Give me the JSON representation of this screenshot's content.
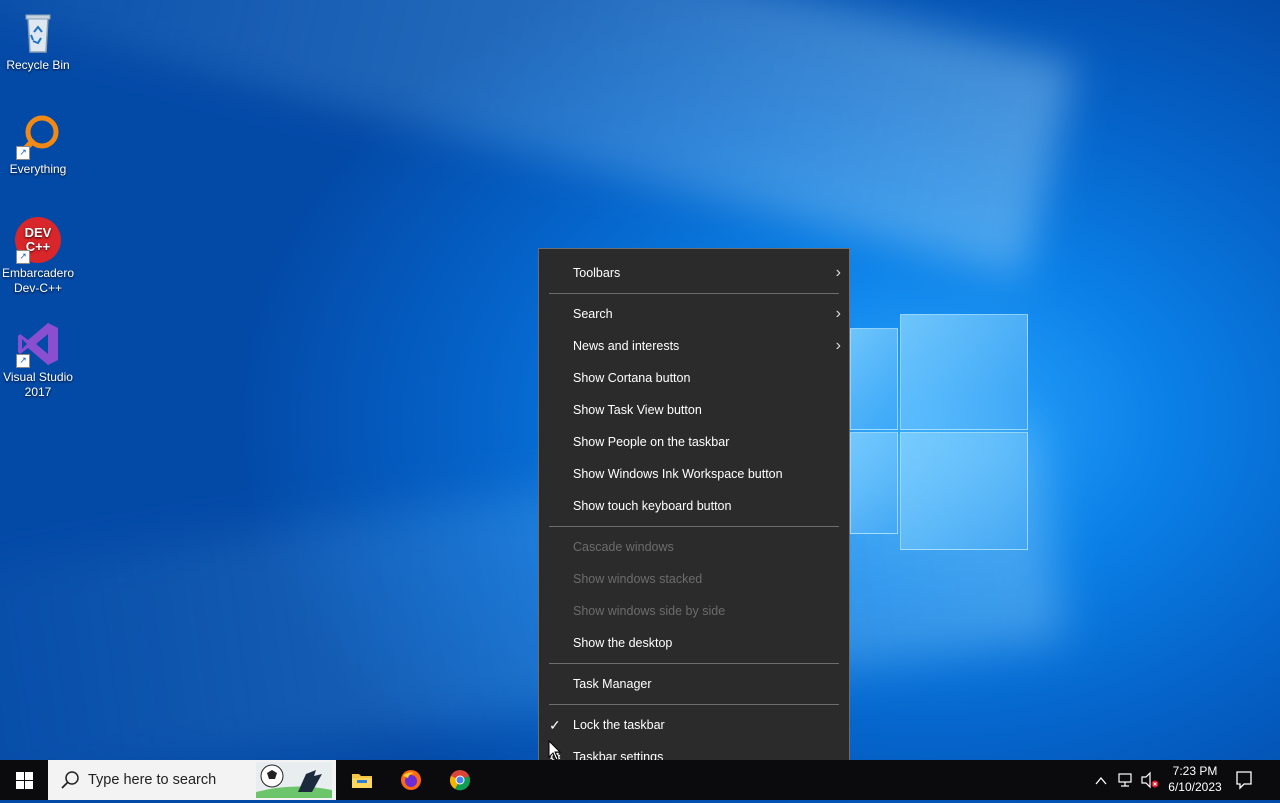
{
  "desktop": {
    "icons": [
      {
        "label": "Recycle Bin",
        "icon": "recycle-bin-icon"
      },
      {
        "label": "Everything",
        "icon": "everything-search-icon"
      },
      {
        "label": "Embarcadero Dev-C++",
        "icon": "devcpp-icon",
        "badge": "DEV C++"
      },
      {
        "label": "Visual Studio 2017",
        "icon": "visual-studio-icon"
      }
    ]
  },
  "context_menu": {
    "items": [
      {
        "label": "Toolbars",
        "submenu": true
      },
      {
        "label": "Search",
        "submenu": true
      },
      {
        "label": "News and interests",
        "submenu": true
      },
      {
        "label": "Show Cortana button"
      },
      {
        "label": "Show Task View button"
      },
      {
        "label": "Show People on the taskbar"
      },
      {
        "label": "Show Windows Ink Workspace button"
      },
      {
        "label": "Show touch keyboard button"
      },
      {
        "label": "Cascade windows",
        "disabled": true
      },
      {
        "label": "Show windows stacked",
        "disabled": true
      },
      {
        "label": "Show windows side by side",
        "disabled": true
      },
      {
        "label": "Show the desktop"
      },
      {
        "label": "Task Manager"
      },
      {
        "label": "Lock the taskbar",
        "checked": true
      },
      {
        "label": "Taskbar settings",
        "icon": "gear-icon"
      }
    ]
  },
  "taskbar": {
    "search_placeholder": "Type here to search",
    "apps": [
      "file-explorer-icon",
      "firefox-icon",
      "chrome-icon"
    ],
    "clock": {
      "time": "7:23 PM",
      "date": "6/10/2023"
    }
  },
  "colors": {
    "menu_bg": "#2b2b2b",
    "menu_separator": "#6d6d6d",
    "taskbar_bg": "#0b0b0e",
    "desktop_blue": "#0a7fe6"
  }
}
